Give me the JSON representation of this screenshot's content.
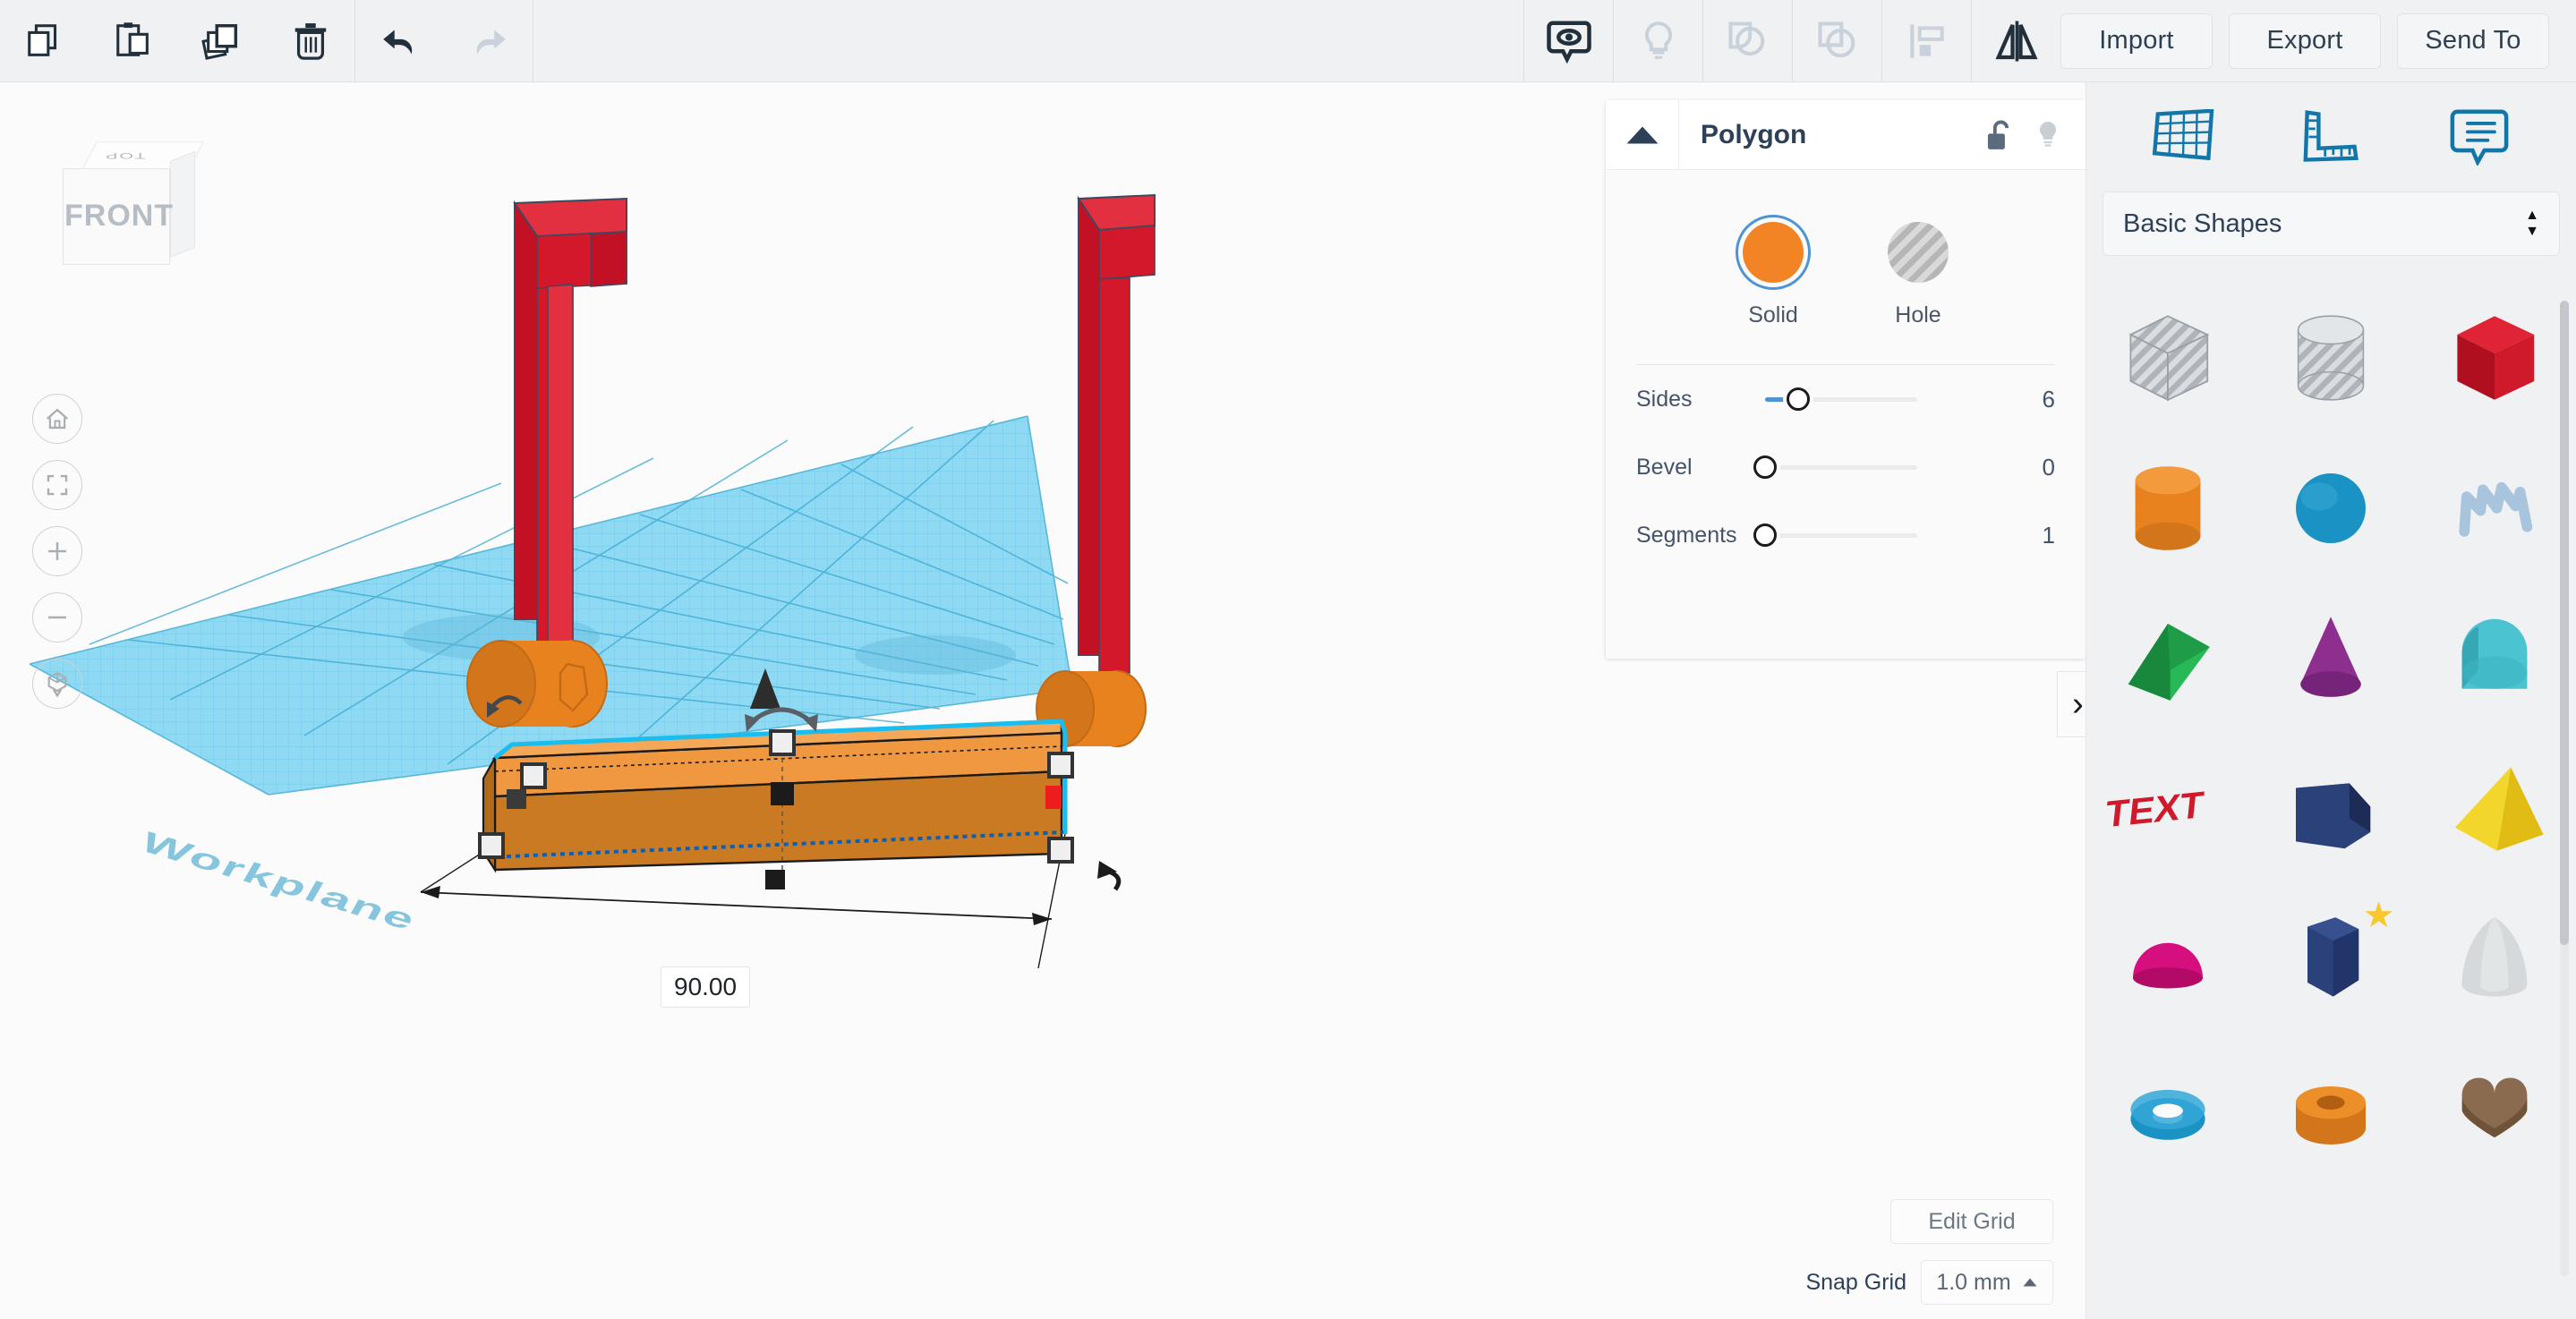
{
  "toolbar": {
    "left_tools": [
      {
        "name": "copy-icon",
        "label": "Copy"
      },
      {
        "name": "paste-icon",
        "label": "Paste"
      },
      {
        "name": "duplicate-icon",
        "label": "Duplicate"
      },
      {
        "name": "delete-icon",
        "label": "Delete"
      }
    ],
    "history_tools": [
      {
        "name": "undo-icon",
        "label": "Undo",
        "enabled": true
      },
      {
        "name": "redo-icon",
        "label": "Redo",
        "enabled": false
      }
    ],
    "view_tools": [
      {
        "name": "notes-eye-icon",
        "label": "Show/Hide",
        "enabled": true
      },
      {
        "name": "lightbulb-icon",
        "label": "Highlight",
        "enabled": false
      },
      {
        "name": "group-icon",
        "label": "Group",
        "enabled": false
      },
      {
        "name": "ungroup-icon",
        "label": "Ungroup",
        "enabled": false
      },
      {
        "name": "align-icon",
        "label": "Align",
        "enabled": false
      },
      {
        "name": "mirror-icon",
        "label": "Mirror",
        "enabled": true
      }
    ],
    "actions": [
      {
        "name": "import-button",
        "label": "Import"
      },
      {
        "name": "export-button",
        "label": "Export"
      },
      {
        "name": "send-to-button",
        "label": "Send To"
      }
    ]
  },
  "viewcube": {
    "top_label": "TOP",
    "front_label": "FRONT"
  },
  "view_controls": [
    {
      "name": "home-view-button",
      "icon": "home-icon"
    },
    {
      "name": "fit-view-button",
      "icon": "fit-frame-icon"
    },
    {
      "name": "zoom-in-button",
      "icon": "plus-icon"
    },
    {
      "name": "zoom-out-button",
      "icon": "minus-icon"
    },
    {
      "name": "ortho-toggle-button",
      "icon": "cube-arrow-icon"
    }
  ],
  "canvas": {
    "workplane_label": "Workplane",
    "dimension_label": "90.00"
  },
  "shape_panel": {
    "title": "Polygon",
    "collapse_icon": "triangle-up-icon",
    "lock_icon": "unlock-icon",
    "light_icon": "lightbulb-icon",
    "modes": [
      {
        "name": "solid-mode",
        "label": "Solid",
        "selected": true,
        "color": "#f28425"
      },
      {
        "name": "hole-mode",
        "label": "Hole",
        "selected": false,
        "color": "#a8a8a8"
      }
    ],
    "sliders": [
      {
        "name": "sides-slider",
        "label": "Sides",
        "value": "6",
        "fill_pct": 22
      },
      {
        "name": "bevel-slider",
        "label": "Bevel",
        "value": "0",
        "fill_pct": 0
      },
      {
        "name": "segments-slider",
        "label": "Segments",
        "value": "1",
        "fill_pct": 0
      }
    ],
    "collapse_tab_icon": "chevron-right-icon"
  },
  "grid_controls": {
    "edit_grid_label": "Edit Grid",
    "snap_grid_label": "Snap Grid",
    "snap_grid_value": "1.0 mm",
    "snap_caret": "caret-up-icon"
  },
  "sidebar": {
    "icons": [
      {
        "name": "workplane-icon",
        "label": "Workplane"
      },
      {
        "name": "ruler-icon",
        "label": "Ruler"
      },
      {
        "name": "note-icon",
        "label": "Note"
      }
    ],
    "category": {
      "label": "Basic Shapes"
    },
    "shapes": [
      {
        "name": "shape-box-hole",
        "label": "Box Hole",
        "kind": "box",
        "color": "#c9ced3",
        "hole": true
      },
      {
        "name": "shape-cylinder-hole",
        "label": "Cylinder Hole",
        "kind": "cylinder",
        "color": "#c9ced3",
        "hole": true
      },
      {
        "name": "shape-box",
        "label": "Box",
        "kind": "box",
        "color": "#cf1a2b",
        "hole": false
      },
      {
        "name": "shape-cylinder",
        "label": "Cylinder",
        "kind": "cylinder",
        "color": "#e8821e",
        "hole": false
      },
      {
        "name": "shape-sphere",
        "label": "Sphere",
        "kind": "sphere",
        "color": "#1b92c4",
        "hole": false
      },
      {
        "name": "shape-scribble",
        "label": "Scribble",
        "kind": "scribble",
        "color": "#a9c5de",
        "hole": false
      },
      {
        "name": "shape-wedge",
        "label": "Wedge",
        "kind": "wedge",
        "color": "#20a149",
        "hole": false
      },
      {
        "name": "shape-cone",
        "label": "Cone",
        "kind": "cone",
        "color": "#8e2f8f",
        "hole": false
      },
      {
        "name": "shape-roof",
        "label": "Roof",
        "kind": "roof",
        "color": "#3fb6c4",
        "hole": false
      },
      {
        "name": "shape-text",
        "label": "TEXT",
        "kind": "text",
        "color": "#cf1a2b",
        "hole": false
      },
      {
        "name": "shape-tube-square",
        "label": "Box Shape",
        "kind": "boxwedge",
        "color": "#23386f",
        "hole": false
      },
      {
        "name": "shape-pyramid",
        "label": "Pyramid",
        "kind": "pyramid",
        "color": "#edcb1c",
        "hole": false
      },
      {
        "name": "shape-half-sphere",
        "label": "Half Sphere",
        "kind": "halfsphere",
        "color": "#d50f7d",
        "hole": false
      },
      {
        "name": "shape-polygon",
        "label": "Polygon",
        "kind": "polygon",
        "color": "#23386f",
        "hole": false,
        "badge": "★"
      },
      {
        "name": "shape-paraboloid",
        "label": "Paraboloid",
        "kind": "paraboloid",
        "color": "#cfd2d4",
        "hole": false
      },
      {
        "name": "shape-torus",
        "label": "Torus",
        "kind": "torus",
        "color": "#1b92c4",
        "hole": false
      },
      {
        "name": "shape-tube",
        "label": "Tube",
        "kind": "tube",
        "color": "#e8821e",
        "hole": false
      },
      {
        "name": "shape-heart",
        "label": "Heart",
        "kind": "heart",
        "color": "#8a6b4f",
        "hole": false
      }
    ]
  },
  "colors": {
    "accent_blue": "#4e94d4",
    "panel_bg": "#fafafa",
    "toolbar_bg": "#f0f1f2",
    "workplane": "#7fd2ef",
    "selection_orange": "#e8821e",
    "post_red": "#cf1a2b"
  }
}
